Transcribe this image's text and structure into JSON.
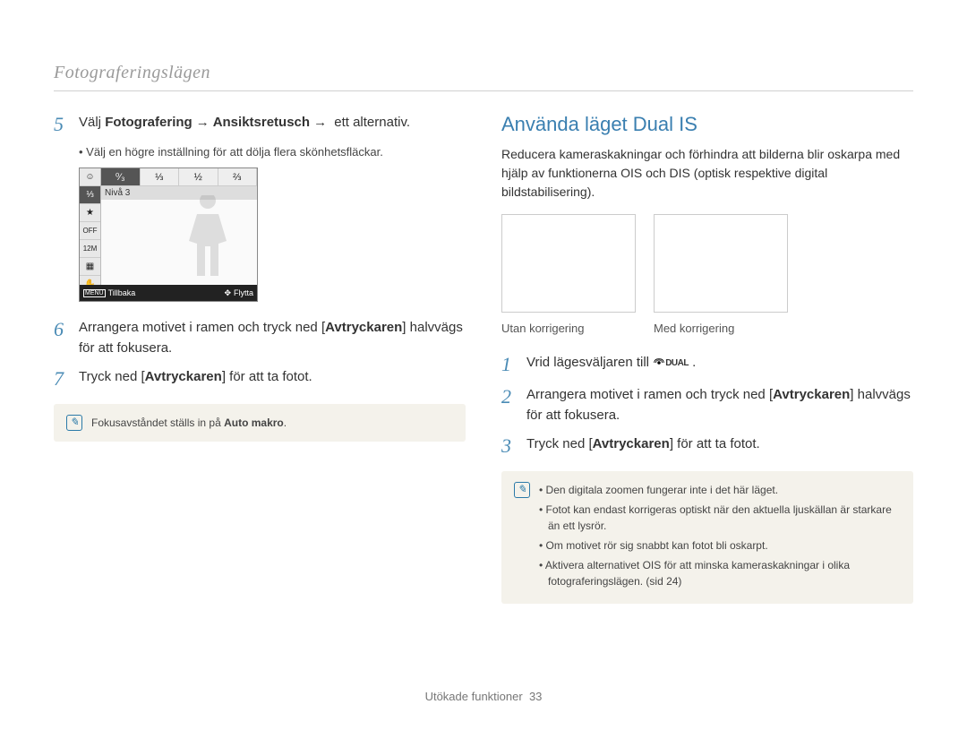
{
  "header": "Fotograferingslägen",
  "left": {
    "step5": {
      "prefix": "Välj ",
      "b1": "Fotografering",
      "b2": "Ansiktsretusch",
      "suffix": " ett alternativ.",
      "bullet": "Välj en högre inställning för att dölja flera skönhetsfläckar."
    },
    "screenshot": {
      "level": "Nivå 3",
      "menu": "MENU",
      "back": "Tillbaka",
      "move": "Flytta"
    },
    "step6": {
      "t1": "Arrangera motivet i ramen och tryck ned [",
      "b": "Avtryckaren",
      "t2": "] halvvägs för att fokusera."
    },
    "step7": {
      "t1": "Tryck ned [",
      "b": "Avtryckaren",
      "t2": "] för att ta fotot."
    },
    "note": {
      "t1": "Fokusavståndet ställs in på ",
      "b": "Auto makro",
      "t2": "."
    }
  },
  "right": {
    "title": "Använda läget Dual IS",
    "intro": "Reducera kameraskakningar och förhindra att bilderna blir oskarpa med hjälp av funktionerna OIS och DIS (optisk respektive digital bildstabilisering).",
    "cap1": "Utan korrigering",
    "cap2": "Med korrigering",
    "step1": {
      "t": "Vrid lägesväljaren till ",
      "icon_label": "DUAL"
    },
    "step2": {
      "t1": "Arrangera motivet i ramen och tryck ned [",
      "b": "Avtryckaren",
      "t2": "] halvvägs för att fokusera."
    },
    "step3": {
      "t1": "Tryck ned [",
      "b": "Avtryckaren",
      "t2": "] för att ta fotot."
    },
    "notes": [
      "Den digitala zoomen fungerar inte i det här läget.",
      "Fotot kan endast korrigeras optiskt när den aktuella ljuskällan är starkare än ett lysrör.",
      "Om motivet rör sig snabbt kan fotot bli oskarpt.",
      "Aktivera alternativet OIS för att minska kameraskakningar i olika fotograferingslägen. (sid 24)"
    ]
  },
  "footer": {
    "label": "Utökade funktioner",
    "page": "33"
  }
}
